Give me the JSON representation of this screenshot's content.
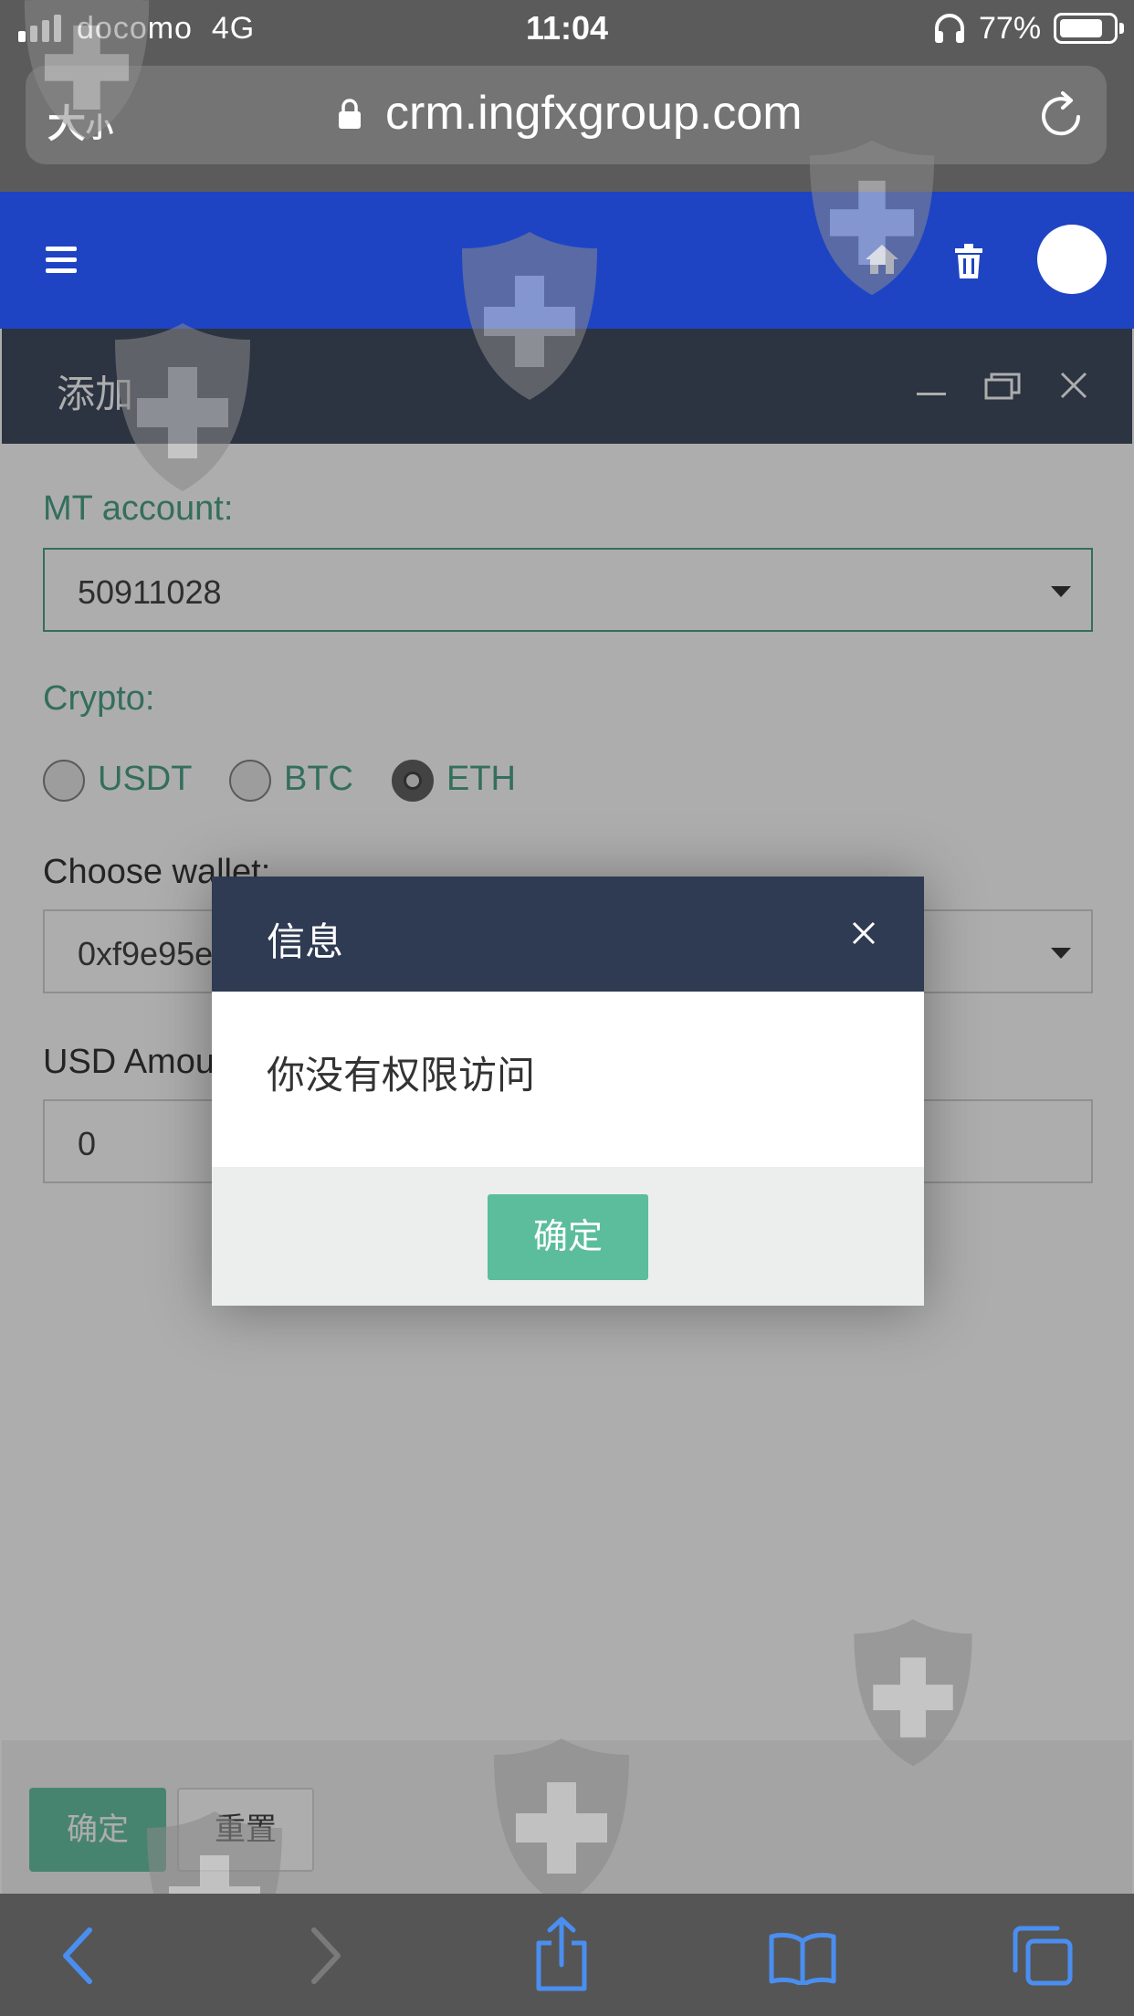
{
  "status_bar": {
    "carrier": "docomo",
    "network": "4G",
    "time": "11:04",
    "battery": "77%"
  },
  "browser": {
    "text_size_big": "大",
    "text_size_small": "小",
    "url": "crm.ingfxgroup.com"
  },
  "window": {
    "title": "添加"
  },
  "form": {
    "mt_account_label": "MT account:",
    "mt_account_value": "50911028",
    "crypto_label": "Crypto:",
    "crypto_options": [
      "USDT",
      "BTC",
      "ETH"
    ],
    "crypto_selected": "ETH",
    "wallet_label": "Choose wallet:",
    "wallet_value": "0xf9e95e",
    "usd_amount_label": "USD Amou",
    "usd_amount_value": "0"
  },
  "footer": {
    "confirm_label": "确定",
    "reset_label": "重置"
  },
  "dialog": {
    "title": "信息",
    "message": "你没有权限访问",
    "ok_label": "确定"
  },
  "colors": {
    "header_blue": "#1e44c4",
    "title_bar": "#2f3b52",
    "accent_green": "#5bbd9c",
    "label_green": "#3d9a7e"
  }
}
